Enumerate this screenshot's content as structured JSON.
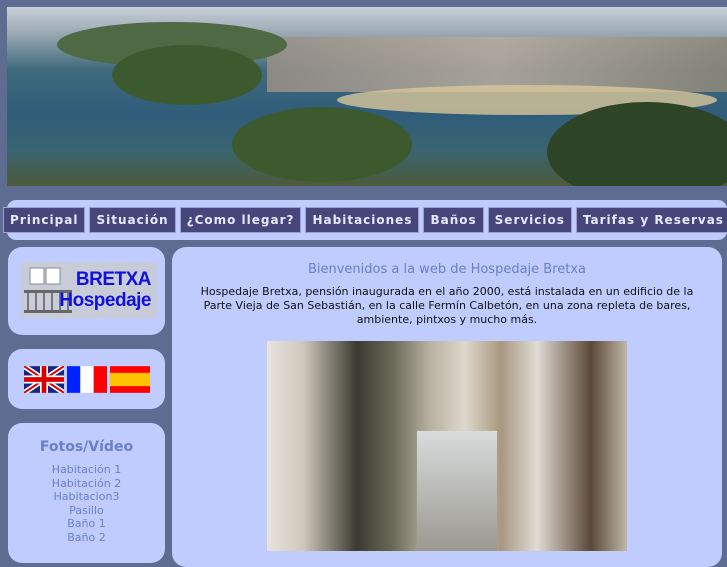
{
  "nav": [
    "Principal",
    "Situación",
    "¿Como llegar?",
    "Habitaciones",
    "Baños",
    "Servicios",
    "Tarifas y Reservas"
  ],
  "logo": {
    "line1": "BRETXA",
    "line2": "Hospedaje"
  },
  "languages": [
    "english",
    "french",
    "spanish"
  ],
  "fotos": {
    "title": "Fotos/Vídeo",
    "items": [
      "Habitación 1",
      "Habitación 2",
      "Habitacion3",
      "Pasillo",
      "Baño 1",
      "Baño 2"
    ]
  },
  "main": {
    "title": "Bienvenidos a la web de Hospedaje Bretxa",
    "intro": "Hospedaje Bretxa, pensión inaugurada en el año 2000, está instalada en un edificio de la Parte Vieja de San Sebastián, en la calle Fermín Calbetón, en una zona repleta de bares, ambiente, pintxos y mucho más."
  }
}
